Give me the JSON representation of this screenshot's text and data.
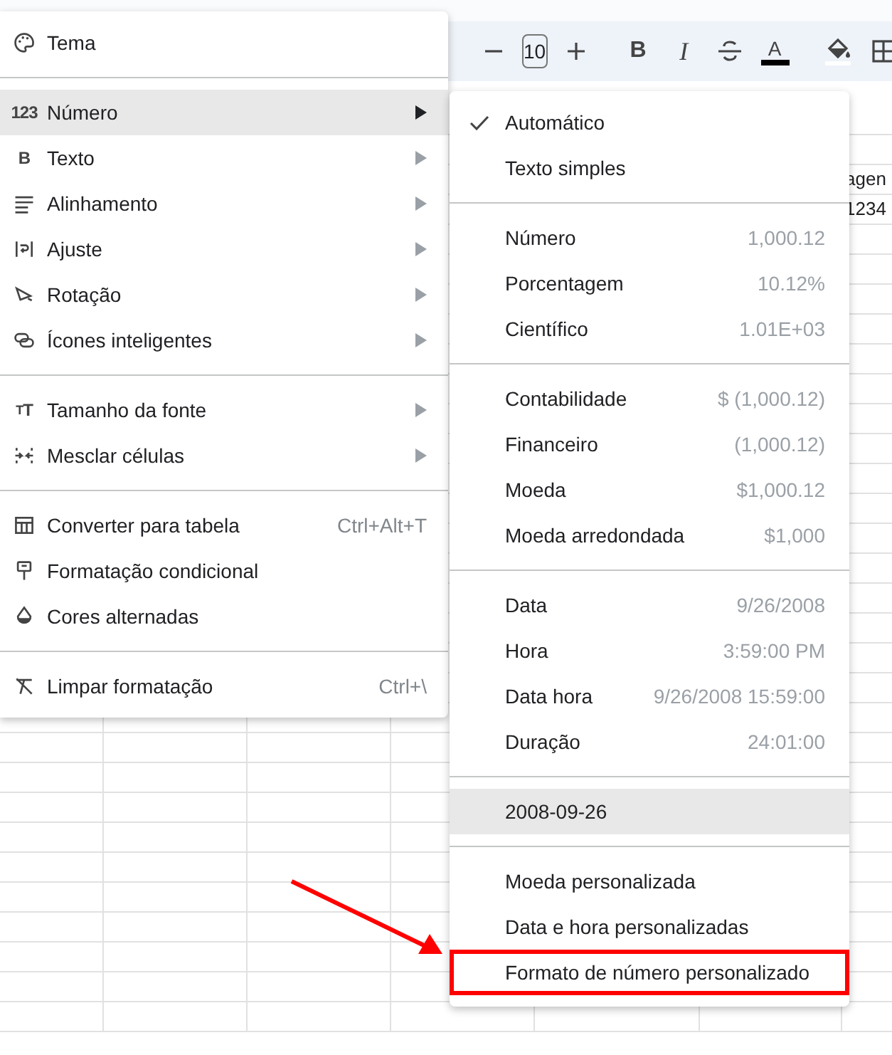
{
  "toolbar": {
    "font_size": "10",
    "bold_label": "B",
    "italic_label": "I",
    "text_color_label": "A"
  },
  "sheet": {
    "visible_cells": [
      {
        "text": "agen"
      },
      {
        "text": "1234"
      }
    ]
  },
  "format_menu": {
    "sections": [
      [
        {
          "label": "Tema",
          "selected": false,
          "has_submenu": false
        }
      ],
      [
        {
          "label": "Número",
          "icon_text": "123",
          "selected": true,
          "has_submenu": true
        },
        {
          "label": "Texto",
          "icon_text": "B",
          "selected": false,
          "has_submenu": true
        },
        {
          "label": "Alinhamento",
          "selected": false,
          "has_submenu": true
        },
        {
          "label": "Ajuste",
          "selected": false,
          "has_submenu": true
        },
        {
          "label": "Rotação",
          "selected": false,
          "has_submenu": true
        },
        {
          "label": "Ícones inteligentes",
          "selected": false,
          "has_submenu": true
        }
      ],
      [
        {
          "label": "Tamanho da fonte",
          "icon_text": "TT",
          "selected": false,
          "has_submenu": true
        },
        {
          "label": "Mesclar células",
          "selected": false,
          "has_submenu": true
        }
      ],
      [
        {
          "label": "Converter para tabela",
          "shortcut": "Ctrl+Alt+T",
          "selected": false,
          "has_submenu": false
        },
        {
          "label": "Formatação condicional",
          "selected": false,
          "has_submenu": false
        },
        {
          "label": "Cores alternadas",
          "selected": false,
          "has_submenu": false
        }
      ],
      [
        {
          "label": "Limpar formatação",
          "shortcut": "Ctrl+\\",
          "selected": false,
          "has_submenu": false
        }
      ]
    ]
  },
  "number_submenu": {
    "sections": [
      [
        {
          "label": "Automático",
          "checked": true,
          "selected": false,
          "boxed": false
        },
        {
          "label": "Texto simples",
          "checked": false,
          "selected": false,
          "boxed": false
        }
      ],
      [
        {
          "label": "Número",
          "example": "1,000.12",
          "checked": false,
          "selected": false,
          "boxed": false
        },
        {
          "label": "Porcentagem",
          "example": "10.12%",
          "checked": false,
          "selected": false,
          "boxed": false
        },
        {
          "label": "Científico",
          "example": "1.01E+03",
          "checked": false,
          "selected": false,
          "boxed": false
        }
      ],
      [
        {
          "label": "Contabilidade",
          "example": "$ (1,000.12)",
          "checked": false,
          "selected": false,
          "boxed": false
        },
        {
          "label": "Financeiro",
          "example": "(1,000.12)",
          "checked": false,
          "selected": false,
          "boxed": false
        },
        {
          "label": "Moeda",
          "example": "$1,000.12",
          "checked": false,
          "selected": false,
          "boxed": false
        },
        {
          "label": "Moeda arredondada",
          "example": "$1,000",
          "checked": false,
          "selected": false,
          "boxed": false
        }
      ],
      [
        {
          "label": "Data",
          "example": "9/26/2008",
          "checked": false,
          "selected": false,
          "boxed": false
        },
        {
          "label": "Hora",
          "example": "3:59:00 PM",
          "checked": false,
          "selected": false,
          "boxed": false
        },
        {
          "label": "Data hora",
          "example": "9/26/2008 15:59:00",
          "checked": false,
          "selected": false,
          "boxed": false
        },
        {
          "label": "Duração",
          "example": "24:01:00",
          "checked": false,
          "selected": false,
          "boxed": false
        }
      ],
      [
        {
          "label": "2008-09-26",
          "checked": false,
          "selected": true,
          "boxed": false
        }
      ],
      [
        {
          "label": "Moeda personalizada",
          "checked": false,
          "selected": false,
          "boxed": false
        },
        {
          "label": "Data e hora personalizadas",
          "checked": false,
          "selected": false,
          "boxed": false
        },
        {
          "label": "Formato de número personalizado",
          "checked": false,
          "selected": false,
          "boxed": true
        }
      ]
    ]
  }
}
